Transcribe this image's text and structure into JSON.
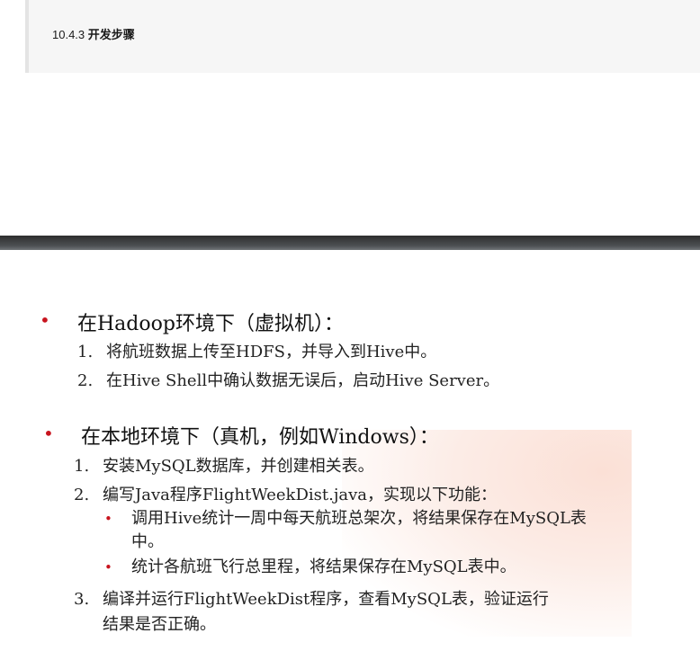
{
  "section": {
    "number": "10.4.3",
    "title": "开发步骤"
  },
  "slide": {
    "groups": [
      {
        "title": "在Hadoop环境下（虚拟机）：",
        "items": [
          {
            "num": "1.",
            "text": "将航班数据上传至HDFS，并导入到Hive中。"
          },
          {
            "num": "2.",
            "text": "在Hive Shell中确认数据无误后，启动Hive Server。"
          }
        ]
      },
      {
        "title": "在本地环境下（真机，例如Windows）：",
        "items": [
          {
            "num": "1.",
            "text": "安装MySQL数据库，并创建相关表。"
          },
          {
            "num": "2.",
            "text": "编写Java程序FlightWeekDist.java，实现以下功能："
          },
          {
            "num": "3.",
            "text_line1": "编译并运行FlightWeekDist程序，查看MySQL表，验证运行",
            "text_line2": "结果是否正确。"
          }
        ],
        "subitems": [
          "调用Hive统计一周中每天航班总架次，将结果保存在MySQL表中。",
          "统计各航班飞行总里程，将结果保存在MySQL表中。"
        ]
      }
    ]
  },
  "colors": {
    "bullet": "#c8141e",
    "divider": "#4c4f52"
  }
}
